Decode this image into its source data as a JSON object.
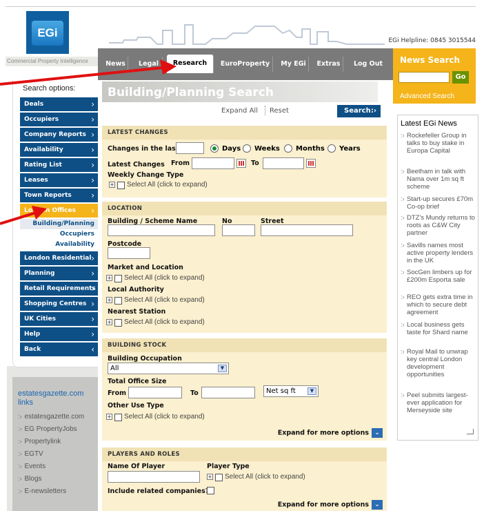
{
  "header": {
    "logo_text": "EGi",
    "helpline": "EGi Helpline: 0845 3015544",
    "tagline": "Commercial Property Intelligence"
  },
  "nav": {
    "tabs": [
      {
        "label": "News",
        "active": false
      },
      {
        "label": "Legal",
        "active": false
      },
      {
        "label": "Research",
        "active": true
      },
      {
        "label": "EuroProperty",
        "active": false
      },
      {
        "label": "My EGi",
        "active": false
      },
      {
        "label": "Extras",
        "active": false
      },
      {
        "label": "Log Out",
        "active": false
      }
    ]
  },
  "news_search": {
    "title": "News Search",
    "go_label": "Go",
    "advanced_label": "Advanced Search"
  },
  "sidebar": {
    "search_options_label": "Search options:",
    "items": [
      {
        "label": "Deals",
        "chevron": "›"
      },
      {
        "label": "Occupiers",
        "chevron": "›"
      },
      {
        "label": "Company Reports",
        "chevron": "›"
      },
      {
        "label": "Availability",
        "chevron": "›"
      },
      {
        "label": "Rating List",
        "chevron": "›"
      },
      {
        "label": "Leases",
        "chevron": "›"
      },
      {
        "label": "Town Reports",
        "chevron": "›"
      },
      {
        "label": "London Offices",
        "chevron": "›"
      },
      {
        "label": "London Residential",
        "chevron": "›"
      },
      {
        "label": "Planning",
        "chevron": "›"
      },
      {
        "label": "Retail Requirements",
        "chevron": "›"
      },
      {
        "label": "Shopping Centres",
        "chevron": "›"
      },
      {
        "label": "UK Cities",
        "chevron": "›"
      },
      {
        "label": "Help",
        "chevron": "›"
      },
      {
        "label": "Back",
        "chevron": "‹"
      }
    ],
    "subitems": [
      "Building/Planning",
      "Occupiers",
      "Availability"
    ]
  },
  "links": {
    "title": "estatesgazette.com links",
    "items": [
      "estatesgazette.com",
      "EG PropertyJobs",
      "Propertylink",
      "EGTV",
      "Events",
      "Blogs",
      "E-newsletters"
    ]
  },
  "main": {
    "page_title": "Building/Planning Search",
    "expand_all": "Expand All",
    "reset": "Reset",
    "search_label": "Search",
    "latest": {
      "heading": "LATEST CHANGES",
      "changes_in_last": "Changes in the last",
      "days": "Days",
      "weeks": "Weeks",
      "months": "Months",
      "years": "Years",
      "latest_changes": "Latest Changes",
      "from": "From",
      "to": "To",
      "weekly_change_type": "Weekly Change Type",
      "select_all": "Select All (click to expand)"
    },
    "location": {
      "heading": "LOCATION",
      "building_name": "Building / Scheme Name",
      "no": "No",
      "street": "Street",
      "postcode": "Postcode",
      "market": "Market and Location",
      "local_authority": "Local Authority",
      "nearest_station": "Nearest Station",
      "select_all": "Select All (click to expand)"
    },
    "stock": {
      "heading": "BUILDING STOCK",
      "occupation": "Building Occupation",
      "occupation_value": "All",
      "total_office": "Total Office Size",
      "from": "From",
      "to": "To",
      "unit_value": "Net sq ft",
      "other_use": "Other Use Type",
      "select_all": "Select All (click to expand)",
      "expand_more": "Expand for more options"
    },
    "players": {
      "heading": "PLAYERS AND ROLES",
      "name_of_player": "Name Of Player",
      "player_type": "Player Type",
      "select_all": "Select All (click to expand)",
      "include_related": "Include related companies?",
      "expand_more": "Expand for more options"
    }
  },
  "news": {
    "title": "Latest EGi News",
    "items": [
      "Rockefeller Group in talks to buy stake in Europa Capital",
      "Beetham in talk with Nama over 1m sq ft scheme",
      "Start-up secures £70m Co-op brief",
      "DTZ's Mundy returns to roots as C&W City partner",
      "Savills names most active property lenders in the UK",
      "SocGen limbers up for £200m Esporta sale",
      "REO gets extra time in which to secure debt agreement",
      "Local business gets taste for Shard name",
      "Royal Mail to unwrap key central London development opportunities",
      "Peel submits largest-ever application for Merseyside site"
    ]
  },
  "colors": {
    "brand_blue": "#0e4f86",
    "accent_orange": "#f4b41a",
    "panel_bg": "#fbf0cf",
    "annotation_red": "#e01010"
  }
}
